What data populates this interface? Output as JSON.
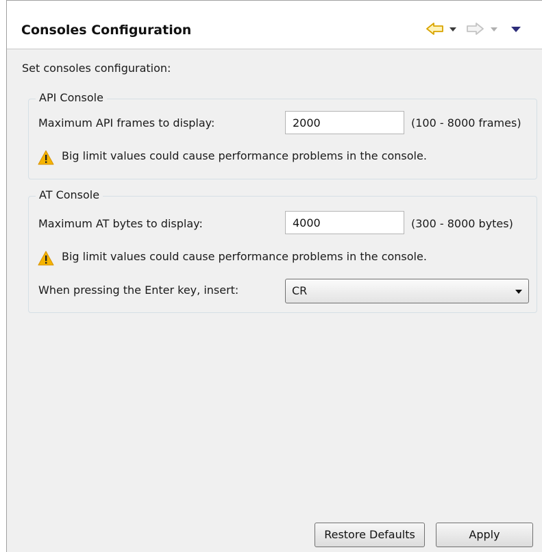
{
  "header": {
    "title": "Consoles Configuration",
    "nav_icons": [
      "back-arrow-icon",
      "back-dropdown-icon",
      "forward-arrow-icon",
      "forward-dropdown-icon",
      "view-menu-icon"
    ]
  },
  "description": "Set consoles configuration:",
  "api_console": {
    "legend": "API Console",
    "max_label": "Maximum API frames to display:",
    "max_value": "2000",
    "range": "(100 - 8000 frames)",
    "warning": "Big limit values could cause performance problems in the console."
  },
  "at_console": {
    "legend": "AT Console",
    "max_label": "Maximum AT bytes to display:",
    "max_value": "4000",
    "range": "(300 - 8000 bytes)",
    "warning": "Big limit values could cause performance problems in the console.",
    "enter_label": "When pressing the Enter key, insert:",
    "enter_value": "CR"
  },
  "buttons": {
    "restore": "Restore Defaults",
    "apply": "Apply"
  },
  "colors": {
    "back_arrow": "#f0b400",
    "disabled_arrow": "#c8c8c8",
    "menu_triangle": "#2d2d7a",
    "warning": "#f5b400"
  }
}
